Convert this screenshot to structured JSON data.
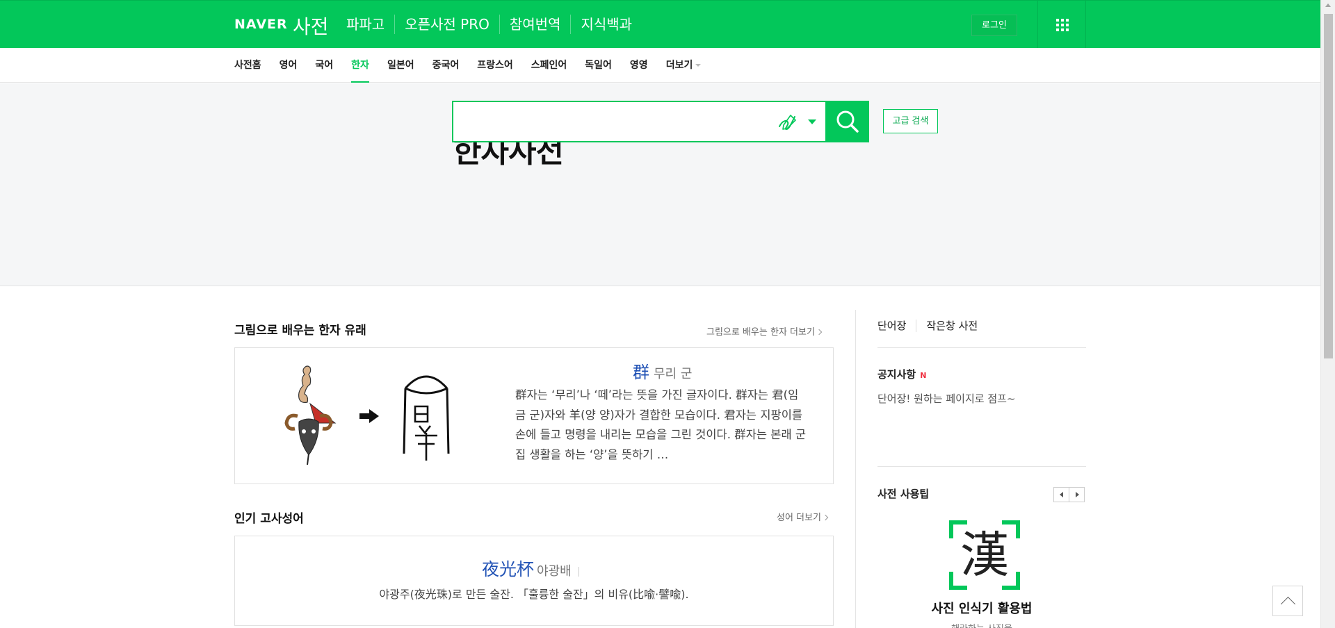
{
  "header": {
    "logo": "NAVER",
    "logo_sub": "사전",
    "nav": [
      "파파고",
      "오픈사전 PRO",
      "참여번역",
      "지식백과"
    ],
    "login_label": "로그인",
    "apps_icon": "grid-icon"
  },
  "lang_tabs": [
    "사전홈",
    "영어",
    "국어",
    "한자",
    "일본어",
    "중국어",
    "프랑스어",
    "스페인어",
    "독일어",
    "영영",
    "더보기"
  ],
  "active_tab": "한자",
  "search": {
    "title": "한자사전",
    "value": "",
    "placeholder": "",
    "handwriting_icon": "handwriting-pen-icon",
    "dropdown_icon": "caret-down-icon",
    "search_icon": "magnifier-icon",
    "advanced_label": "고급 검색"
  },
  "origin_section": {
    "title": "그림으로 배우는 한자 유래",
    "more_label": "그림으로 배우는 한자 더보기",
    "hanja": "群",
    "reading": "무리 군",
    "description": "群자는 ‘무리’나 ‘떼’라는 뜻을 가진 글자이다. 群자는 君(임금 군)자와 羊(양 양)자가 결합한 모습이다. 君자는 지팡이를 손에 들고 명령을 내리는 모습을 그린 것이다. 群자는 본래 군집 생활을 하는 ‘양’을 뜻하기 …"
  },
  "idiom_section": {
    "title": "인기 고사성어",
    "more_label": "성어 더보기",
    "hanja": "夜光杯",
    "reading": "야광배",
    "description": "야광주(夜光珠)로 만든 술잔. 「훌륭한 술잔」의 비유(比喩·譬喩)."
  },
  "sidebar": {
    "tabs": [
      "단어장",
      "작은창 사전"
    ],
    "notice_title": "공지사항",
    "notice_badge": "N",
    "notice_text": "단어장! 원하는 페이지로 점프~",
    "tips_title": "사전 사용팁",
    "tip_char": "漢",
    "tip_caption": "사진 인식기 활용법",
    "tip_sub": "해라하는 사진을"
  },
  "colors": {
    "brand_green": "#03c75a",
    "hanja_blue": "#2152b5",
    "new_badge_red": "#ef2d3d"
  }
}
